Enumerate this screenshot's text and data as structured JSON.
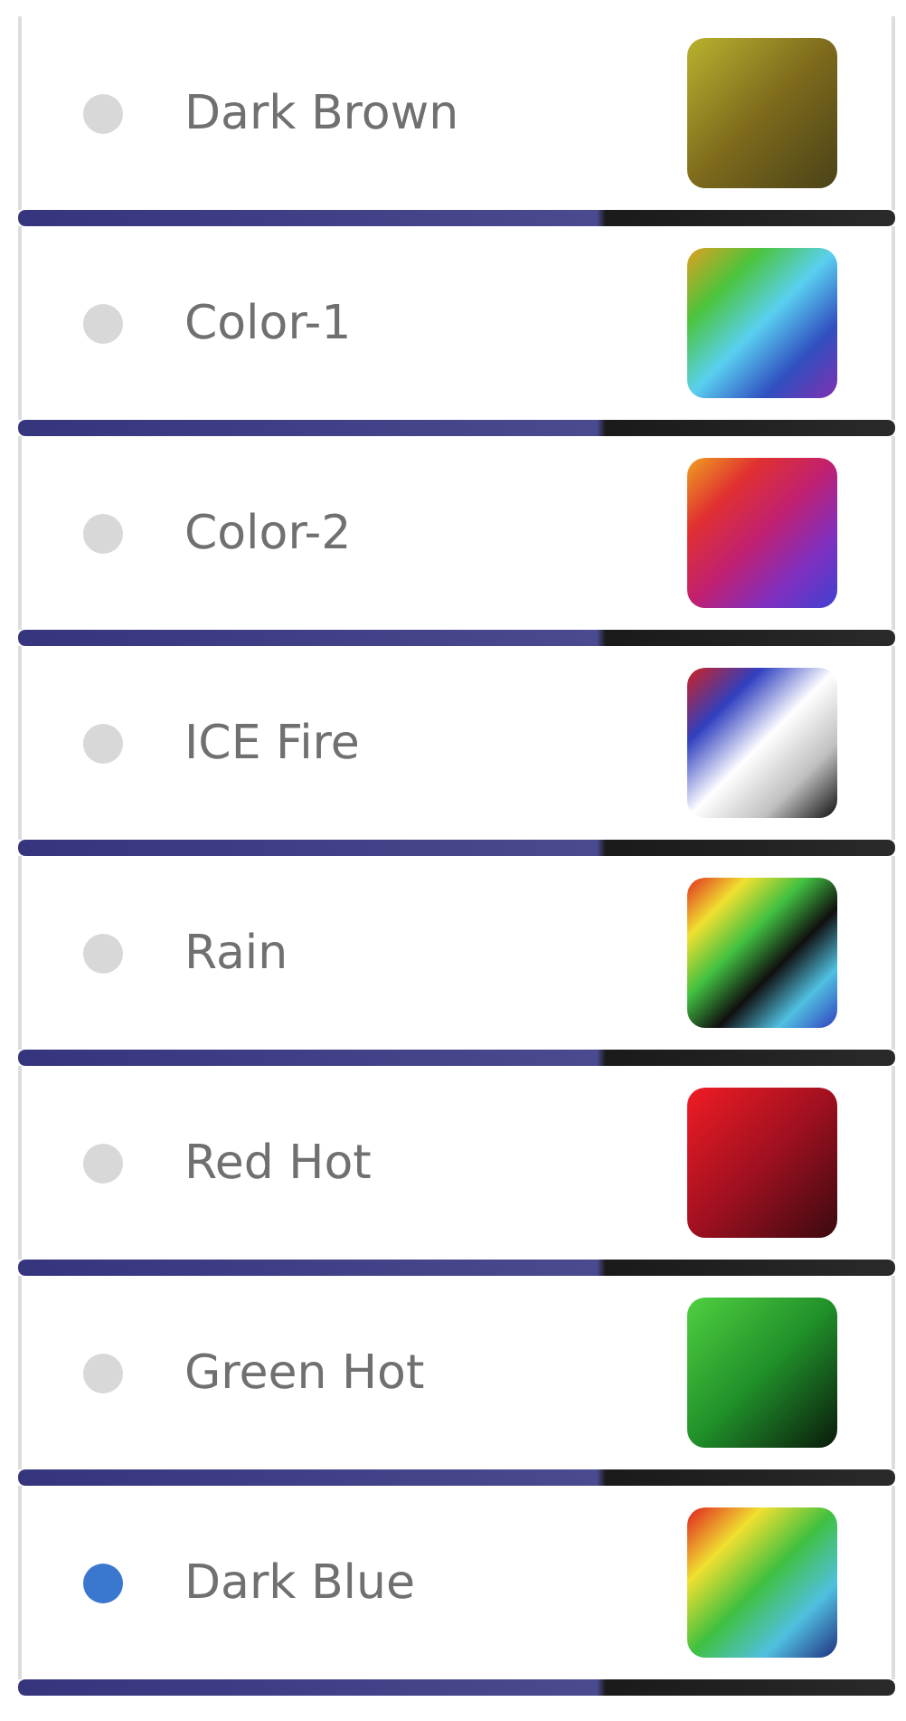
{
  "palettes": [
    {
      "label": "Dark Brown",
      "selected": false,
      "kind": "brown"
    },
    {
      "label": "Color-1",
      "selected": false,
      "kind": "spectrum"
    },
    {
      "label": "Color-2",
      "selected": false,
      "kind": "sunset"
    },
    {
      "label": "ICE Fire",
      "selected": false,
      "kind": "icefire"
    },
    {
      "label": "Rain",
      "selected": false,
      "kind": "rain"
    },
    {
      "label": "Red Hot",
      "selected": false,
      "kind": "redhot"
    },
    {
      "label": "Green Hot",
      "selected": false,
      "kind": "greenhot"
    },
    {
      "label": "Dark Blue",
      "selected": true,
      "kind": "rainbow"
    }
  ]
}
